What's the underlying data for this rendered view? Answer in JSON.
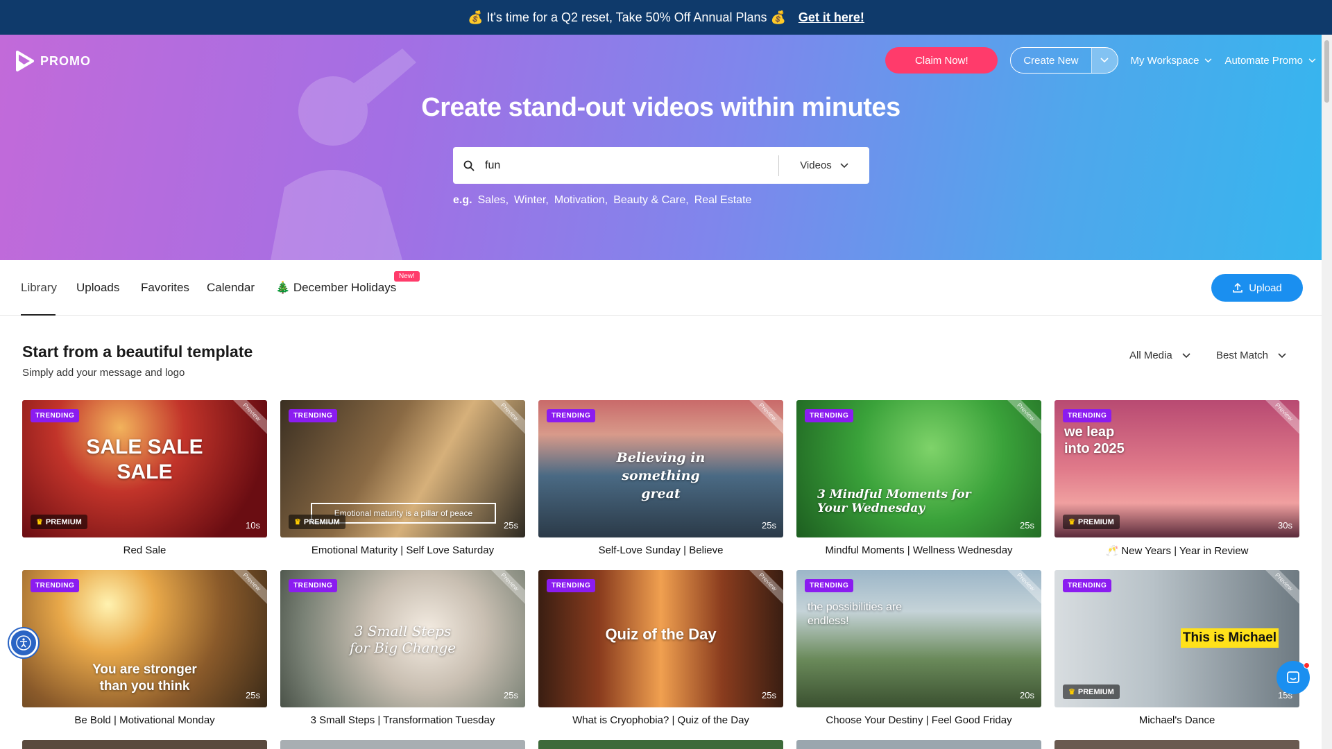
{
  "banner": {
    "text": "💰 It's time for a Q2 reset, Take 50% Off Annual Plans 💰",
    "link": "Get it here!"
  },
  "brand": {
    "name": "PROMO"
  },
  "nav": {
    "claim": "Claim Now!",
    "create": "Create New",
    "workspace": "My Workspace",
    "automate": "Automate Promo"
  },
  "hero": {
    "title": "Create stand-out videos within minutes"
  },
  "search": {
    "value": "fun",
    "type": "Videos"
  },
  "examples": {
    "label": "e.g.",
    "items": [
      "Sales,",
      "Winter,",
      "Motivation,",
      "Beauty & Care,",
      "Real Estate"
    ]
  },
  "tabs": {
    "library": "Library",
    "uploads": "Uploads",
    "favorites": "Favorites",
    "calendar": "Calendar",
    "holidays": "🎄 December Holidays",
    "new_badge": "New!",
    "upload": "Upload"
  },
  "section": {
    "title": "Start from a beautiful template",
    "subtitle": "Simply add your message and logo",
    "media_filter": "All Media",
    "sort": "Best Match"
  },
  "labels": {
    "trending": "TRENDING",
    "premium": "PREMIUM",
    "preview": "Preview"
  },
  "cards": [
    {
      "title": "Red Sale",
      "duration": "10s",
      "premium": true,
      "overlay": "SALE SALE SALE"
    },
    {
      "title": "Emotional Maturity | Self Love Saturday",
      "duration": "25s",
      "premium": true,
      "overlay": "Emotional maturity is a pillar of peace"
    },
    {
      "title": "Self-Love Sunday | Believe",
      "duration": "25s",
      "premium": false,
      "overlay": "Believing in something great"
    },
    {
      "title": "Mindful Moments | Wellness Wednesday",
      "duration": "25s",
      "premium": false,
      "overlay": "3 Mindful Moments for Your Wednesday"
    },
    {
      "title": "🥂 New Years | Year in Review",
      "duration": "30s",
      "premium": true,
      "overlay": "we leap into 2025"
    },
    {
      "title": "Be Bold | Motivational Monday",
      "duration": "25s",
      "premium": false,
      "overlay": "You are stronger than you think"
    },
    {
      "title": "3 Small Steps | Transformation Tuesday",
      "duration": "25s",
      "premium": false,
      "overlay": "3 Small Steps for Big Change"
    },
    {
      "title": "What is Cryophobia? | Quiz of the Day",
      "duration": "25s",
      "premium": false,
      "overlay": "Quiz of the Day"
    },
    {
      "title": "Choose Your Destiny | Feel Good Friday",
      "duration": "20s",
      "premium": false,
      "overlay": "the possibilities are endless!"
    },
    {
      "title": "Michael's Dance",
      "duration": "15s",
      "premium": true,
      "overlay": "This is Michael"
    }
  ]
}
